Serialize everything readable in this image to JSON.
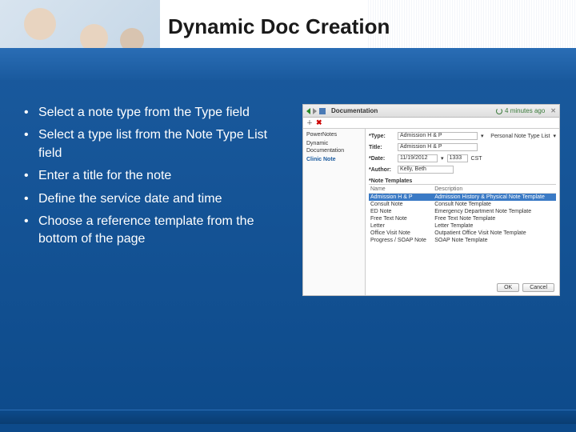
{
  "slide": {
    "title": "Dynamic Doc Creation",
    "bullets": [
      "Select a note type from the Type field",
      "Select a type list from the Note Type List field",
      "Enter a title for the note",
      "Define the service date and time",
      "Choose a reference template from the bottom of the page"
    ]
  },
  "app": {
    "section": "Documentation",
    "refresh_ago": "4 minutes ago",
    "sidebar": {
      "items": [
        {
          "label": "PowerNotes",
          "bold": false
        },
        {
          "label": "Dynamic Documentation",
          "bold": false
        },
        {
          "label": "Clinic Note",
          "bold": true
        }
      ]
    },
    "form": {
      "type_label": "*Type:",
      "type_value": "Admission H & P",
      "type_list_label": "Personal Note Type List",
      "date_label": "*Date:",
      "date_value": "11/19/2012",
      "time_value": "1333",
      "tz": "CST",
      "title_label": "Title:",
      "title_value": "Admission H & P",
      "author_label": "*Author:",
      "author_value": "Kelly, Beth"
    },
    "templates": {
      "heading": "*Note Templates",
      "columns": [
        "Name",
        "Description"
      ],
      "rows": [
        {
          "name": "Admission H & P",
          "desc": "Admission History & Physical Note Template",
          "selected": true
        },
        {
          "name": "Consult Note",
          "desc": "Consult Note Template",
          "selected": false
        },
        {
          "name": "ED Note",
          "desc": "Emergency Department Note Template",
          "selected": false
        },
        {
          "name": "Free Text Note",
          "desc": "Free Text Note Template",
          "selected": false
        },
        {
          "name": "Letter",
          "desc": "Letter Template",
          "selected": false
        },
        {
          "name": "Office Visit Note",
          "desc": "Outpatient Office Visit Note Template",
          "selected": false
        },
        {
          "name": "Progress / SOAP Note",
          "desc": "SOAP Note Template",
          "selected": false
        }
      ]
    },
    "buttons": {
      "ok": "OK",
      "cancel": "Cancel"
    }
  }
}
